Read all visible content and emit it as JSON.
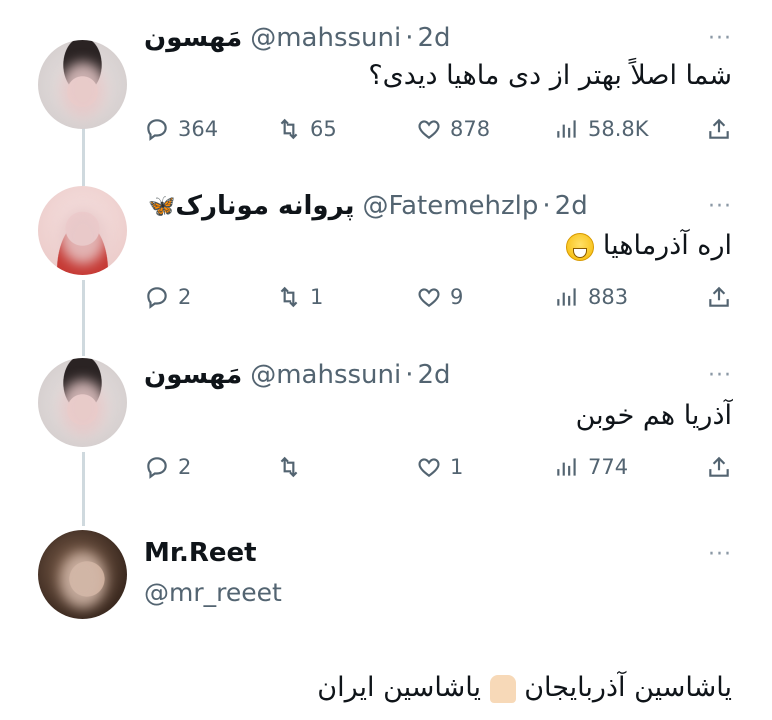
{
  "tweets": [
    {
      "name": "مَهسون",
      "handle": "@mahssuni",
      "time": "2d",
      "text": "شما اصلاً بهتر از دی ماهیا دیدی؟",
      "replies": "364",
      "retweets": "65",
      "likes": "878",
      "views": "58.8K"
    },
    {
      "name": "پروانه مونارک",
      "handle": "@Fatemehzlp",
      "time": "2d",
      "text": "اره آذرماهیا",
      "replies": "2",
      "retweets": "1",
      "likes": "9",
      "views": "883"
    },
    {
      "name": "مَهسون",
      "handle": "@mahssuni",
      "time": "2d",
      "text": "آذریا هم خوبن",
      "replies": "2",
      "retweets": "",
      "likes": "1",
      "views": "774"
    }
  ],
  "main_tweet": {
    "name": "Mr.Reet",
    "handle": "@mr_reeet",
    "text_part1": "یاشاسین آذربایجان",
    "text_part2": "یاشاسین ایران"
  },
  "icons": [
    "reply-icon",
    "retweet-icon",
    "like-icon",
    "views-icon",
    "share-icon",
    "more-icon",
    "butterfly-emoji",
    "grin-emoji",
    "raised-hands-emoji"
  ],
  "colors": {
    "text": "#0f1419",
    "secondary": "#536471",
    "thread_line": "#cfd9de",
    "background": "#ffffff"
  },
  "dot": "·",
  "more": "···"
}
